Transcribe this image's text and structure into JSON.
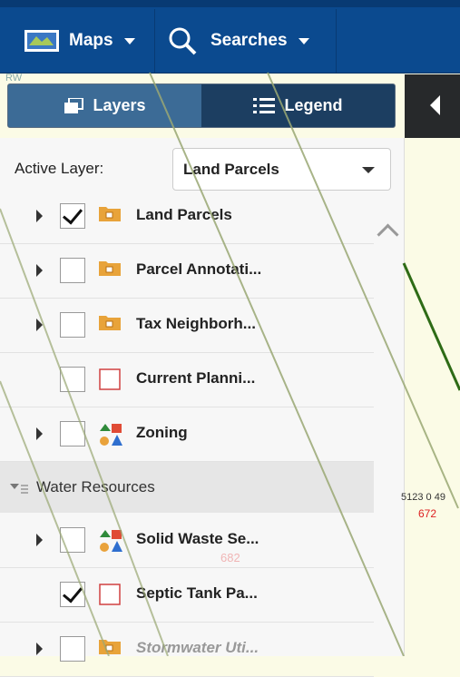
{
  "toolbar": {
    "maps_label": "Maps",
    "searches_label": "Searches"
  },
  "corner_label": "RW",
  "tabs": [
    {
      "label": "Layers",
      "active": true
    },
    {
      "label": "Legend",
      "active": false
    }
  ],
  "active_layer": {
    "label": "Active Layer:",
    "value": "Land Parcels"
  },
  "layers": [
    {
      "label": "Land Parcels",
      "checked": true,
      "expandable": true,
      "icon": "folder-icon"
    },
    {
      "label": "Parcel Annotati...",
      "checked": false,
      "expandable": true,
      "icon": "folder-icon"
    },
    {
      "label": "Tax Neighborh...",
      "checked": false,
      "expandable": true,
      "icon": "folder-icon"
    },
    {
      "label": "Current Planni...",
      "checked": false,
      "expandable": false,
      "icon": "polygon-outline-icon"
    },
    {
      "label": "Zoning",
      "checked": false,
      "expandable": true,
      "icon": "shapes-icon"
    }
  ],
  "group": {
    "label": "Water Resources"
  },
  "group_layers": [
    {
      "label": "Solid Waste Se...",
      "checked": false,
      "expandable": true,
      "icon": "shapes-icon"
    },
    {
      "label": "Septic Tank Pa...",
      "checked": true,
      "expandable": false,
      "icon": "polygon-outline-icon"
    },
    {
      "label": "Stormwater Uti...",
      "checked": false,
      "expandable": true,
      "icon": "folder-icon",
      "disabled": true
    }
  ],
  "map": {
    "parcel_text": "5123 0 49",
    "parcel_num": "672",
    "ghost_num": "682"
  },
  "colors": {
    "toolbar": "#0b4a8f",
    "tab_active": "#3c6b96",
    "map_bg": "#fbfbe6",
    "folder": "#e8a33a"
  }
}
